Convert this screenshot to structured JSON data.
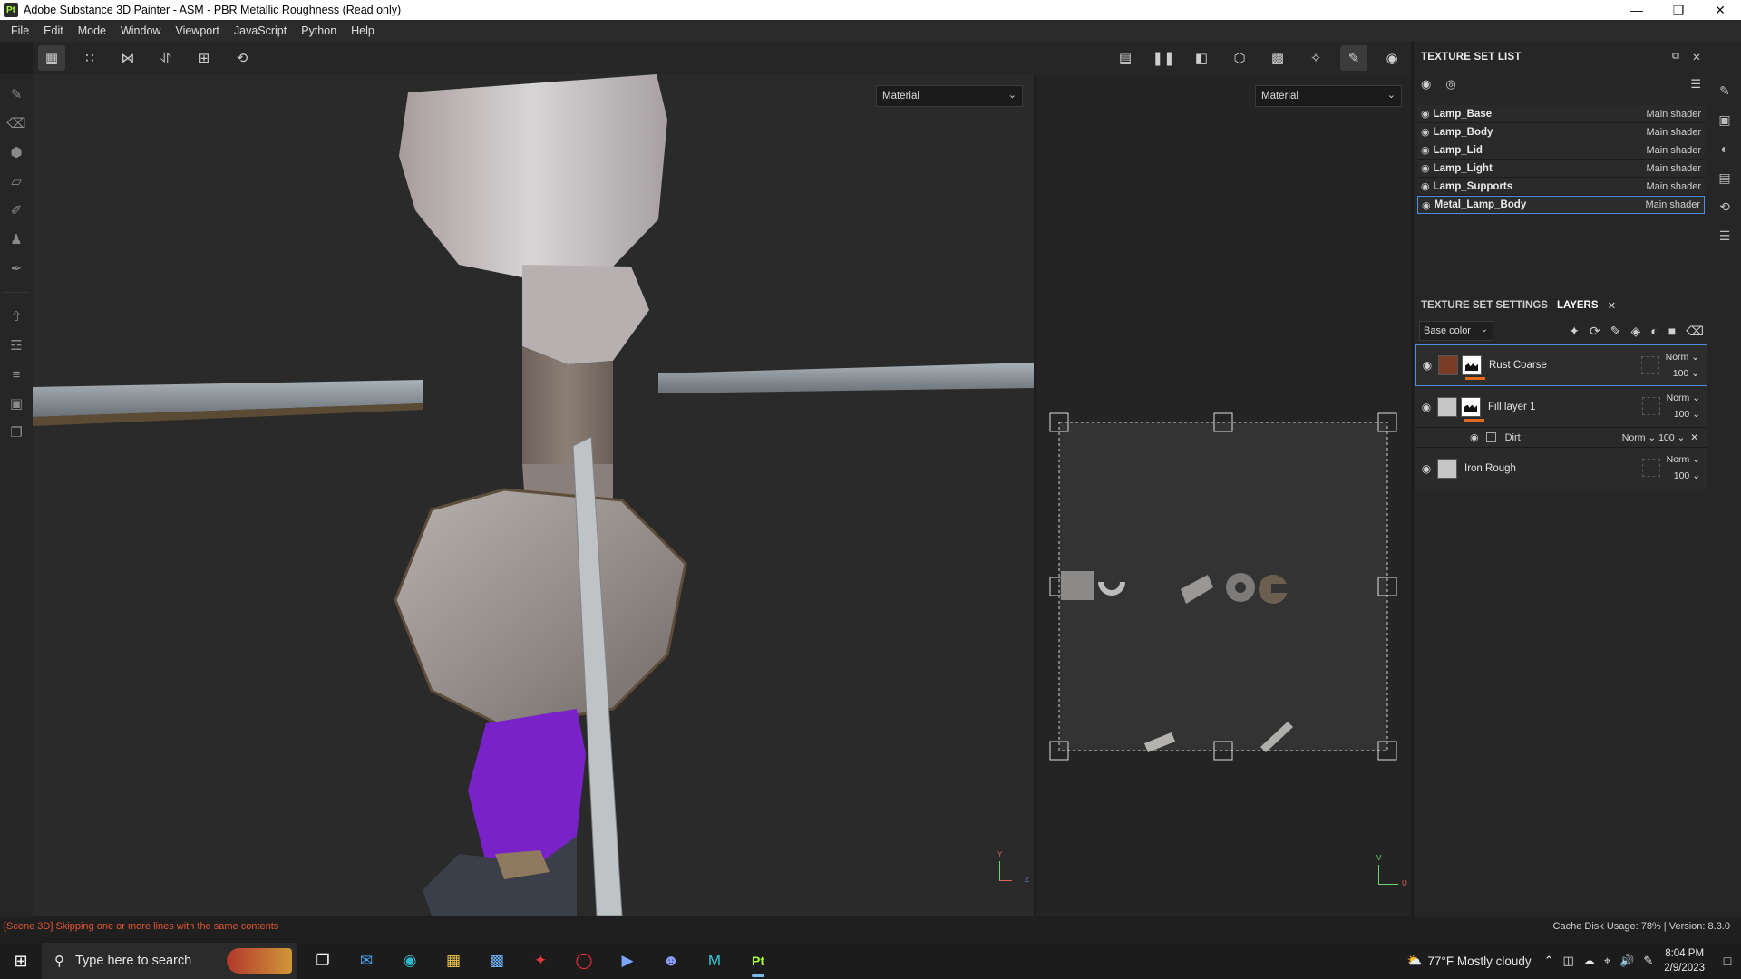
{
  "window": {
    "app_icon": "Pt",
    "title": "Adobe Substance 3D Painter - ASM - PBR Metallic Roughness (Read only)",
    "controls": [
      "minimize-icon",
      "restore-icon",
      "close-icon"
    ]
  },
  "menu": [
    "File",
    "Edit",
    "Mode",
    "Window",
    "Viewport",
    "JavaScript",
    "Python",
    "Help"
  ],
  "viewport_3d": {
    "material_select": "Material",
    "axis_labels": [
      "Y",
      "Z"
    ]
  },
  "viewport_2d": {
    "material_select": "Material",
    "axis_labels": [
      "V",
      "U"
    ]
  },
  "texture_set_list": {
    "title": "TEXTURE SET LIST",
    "items": [
      {
        "name": "Lamp_Base",
        "shader": "Main shader"
      },
      {
        "name": "Lamp_Body",
        "shader": "Main shader"
      },
      {
        "name": "Lamp_Lid",
        "shader": "Main shader"
      },
      {
        "name": "Lamp_Light",
        "shader": "Main shader"
      },
      {
        "name": "Lamp_Supports",
        "shader": "Main shader"
      },
      {
        "name": "Metal_Lamp_Body",
        "shader": "Main shader",
        "selected": true
      }
    ]
  },
  "layers_panel": {
    "tabs": [
      "TEXTURE SET SETTINGS",
      "LAYERS"
    ],
    "active_tab": "LAYERS",
    "channel": "Base color",
    "layers": [
      {
        "name": "Rust Coarse",
        "blend": "Norm",
        "opacity": "100",
        "selected": true,
        "color": "#7a3c26",
        "underline": "#e46a1f"
      },
      {
        "name": "Fill layer 1",
        "blend": "Norm",
        "opacity": "100",
        "color": "#c6c6c6",
        "underline": "#e46a1f",
        "effects": [
          {
            "name": "Dirt",
            "blend": "Norm",
            "opacity": "100"
          }
        ]
      },
      {
        "name": "Iron Rough",
        "blend": "Norm",
        "opacity": "100",
        "color": "#c6c6c6"
      }
    ]
  },
  "status": {
    "message": "[Scene 3D] Skipping one or more lines with the same contents",
    "cache": "Cache Disk Usage:  78% | Version: 8.3.0"
  },
  "taskbar": {
    "search_placeholder": "Type here to search",
    "weather": "77°F  Mostly cloudy",
    "time": "8:04 PM",
    "date": "2/9/2023",
    "active_app": "Pt"
  },
  "colors": {
    "accent": "#4f8de0",
    "status_error": "#e05533",
    "rust_underline": "#e46a1f",
    "purple_mesh": "#7a22c9"
  }
}
